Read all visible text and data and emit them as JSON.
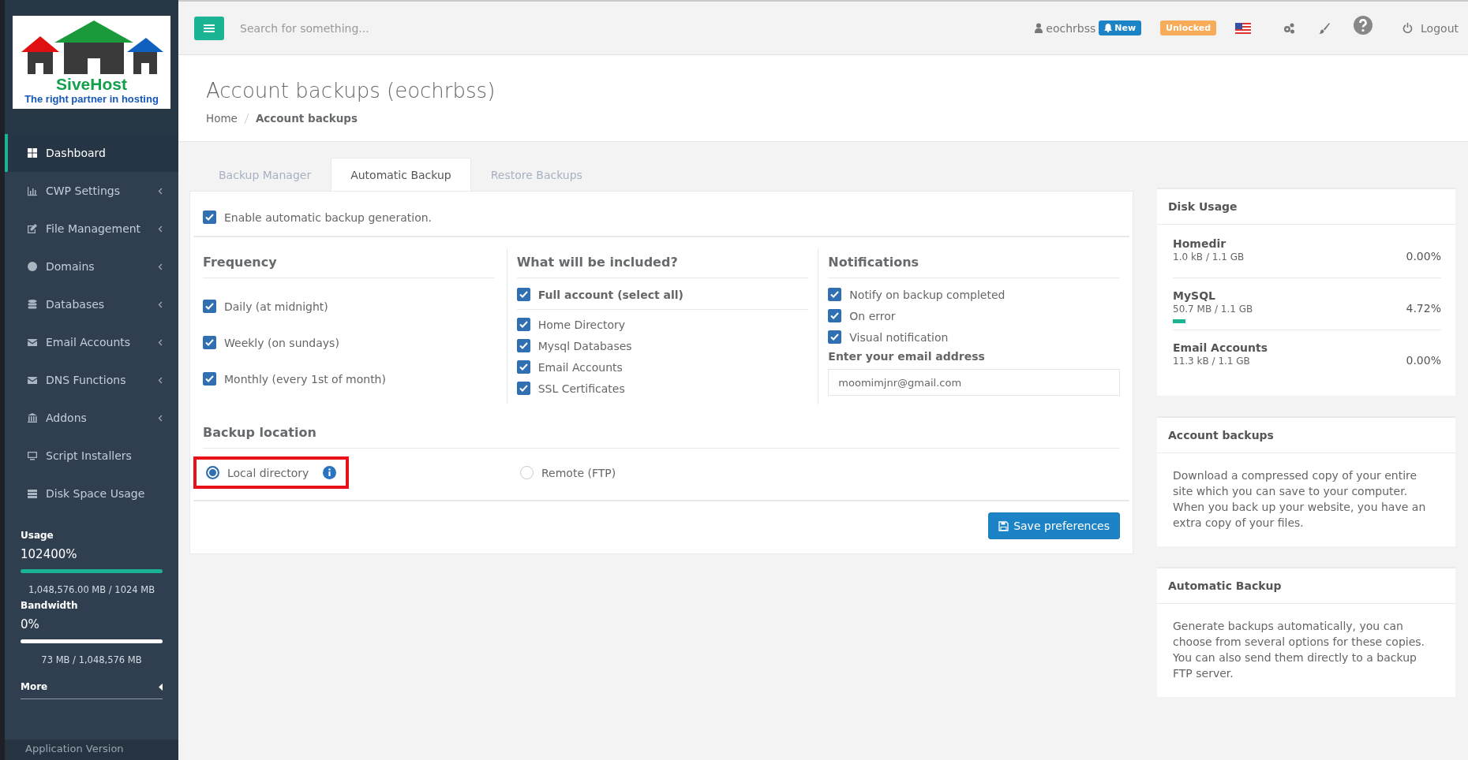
{
  "logo": {
    "name": "SiveHost",
    "tagline": "The right partner in hosting"
  },
  "sidebar": {
    "items": [
      {
        "label": "Dashboard",
        "selected": true,
        "submenu": false
      },
      {
        "label": "CWP Settings",
        "selected": false,
        "submenu": true
      },
      {
        "label": "File Management",
        "selected": false,
        "submenu": true
      },
      {
        "label": "Domains",
        "selected": false,
        "submenu": true
      },
      {
        "label": "Databases",
        "selected": false,
        "submenu": true
      },
      {
        "label": "Email Accounts",
        "selected": false,
        "submenu": true
      },
      {
        "label": "DNS Functions",
        "selected": false,
        "submenu": true
      },
      {
        "label": "Addons",
        "selected": false,
        "submenu": true
      },
      {
        "label": "Script Installers",
        "selected": false,
        "submenu": false
      },
      {
        "label": "Disk Space Usage",
        "selected": false,
        "submenu": false
      }
    ],
    "meters": [
      {
        "label": "Usage",
        "percent": "102400%",
        "level": 1,
        "detail": "1,048,576.00 MB / 1024 MB"
      },
      {
        "label": "Bandwidth",
        "percent": "0%",
        "level": 0,
        "detail": "73 MB / 1,048,576 MB"
      }
    ],
    "more": "More",
    "footer": "Application Version"
  },
  "topbar": {
    "search_placeholder": "Search for something...",
    "user": "eochrbss",
    "new_badge": "New",
    "unlocked_badge": "Unlocked",
    "logout": "Logout"
  },
  "page": {
    "title": "Account backups (eochrbss)",
    "breadcrumb": [
      "Home",
      "Account backups"
    ]
  },
  "tabs": [
    {
      "label": "Backup Manager",
      "selected": false
    },
    {
      "label": "Automatic Backup",
      "selected": true
    },
    {
      "label": "Restore Backups",
      "selected": false
    }
  ],
  "enable": {
    "label": "Enable automatic backup generation.",
    "checked": true
  },
  "frequency": {
    "title": "Frequency",
    "options": [
      {
        "label": "Daily (at midnight)",
        "checked": true
      },
      {
        "label": "Weekly (on sundays)",
        "checked": true
      },
      {
        "label": "Monthly (every 1st of month)",
        "checked": true
      }
    ]
  },
  "included": {
    "title": "What will be included?",
    "all": {
      "label": "Full account (select all)",
      "checked": true
    },
    "options": [
      {
        "label": "Home Directory",
        "checked": true
      },
      {
        "label": "Mysql Databases",
        "checked": true
      },
      {
        "label": "Email Accounts",
        "checked": true
      },
      {
        "label": "SSL Certificates",
        "checked": true
      }
    ]
  },
  "notifications": {
    "title": "Notifications",
    "options": [
      {
        "label": "Notify on backup completed",
        "checked": true
      },
      {
        "label": "On error",
        "checked": true
      },
      {
        "label": "Visual notification",
        "checked": true
      }
    ],
    "email_label": "Enter your email address",
    "email": "moomimjnr@gmail.com"
  },
  "location": {
    "title": "Backup location",
    "options": [
      {
        "label": "Local directory",
        "selected": true,
        "highlighted": true,
        "info": true
      },
      {
        "label": "Remote (FTP)",
        "selected": false,
        "highlighted": false,
        "info": false
      }
    ]
  },
  "save_button": "Save preferences",
  "disk_usage": {
    "title": "Disk Usage",
    "items": [
      {
        "name": "Homedir",
        "detail": "1.0 kB / 1.1 GB",
        "percent": "0.00%",
        "level": 0
      },
      {
        "name": "MySQL",
        "detail": "50.7 MB / 1.1 GB",
        "percent": "4.72%",
        "level": 0.0472
      },
      {
        "name": "Email Accounts",
        "detail": "11.3 kB / 1.1 GB",
        "percent": "0.00%",
        "level": 0
      }
    ]
  },
  "info_cards": [
    {
      "title": "Account backups",
      "text": "Download a compressed copy of your entire site which you can save to your computer. When you back up your website, you have an extra copy of your files."
    },
    {
      "title": "Automatic Backup",
      "text": "Generate backups automatically, you can choose from several options for these copies. You can also send them directly to a backup FTP server."
    }
  ]
}
